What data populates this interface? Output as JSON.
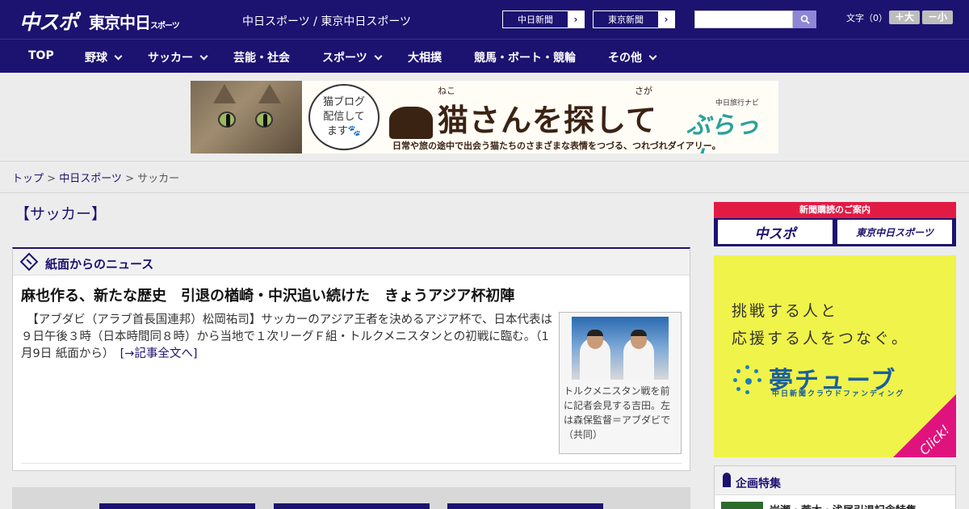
{
  "header": {
    "logo_chuspo": "中スポ",
    "logo_tokyo": "東京中日",
    "logo_tokyo_small": "スポーツ",
    "site_names": "中日スポーツ / 東京中日スポーツ",
    "btn_chunichi": "中日新聞",
    "btn_tokyo": "東京新聞",
    "arrow": "›",
    "search_placeholder": "",
    "fontsize_label": "文字（0）",
    "font_larger": "＋大",
    "font_smaller": "－小"
  },
  "nav": {
    "items": [
      {
        "label": "TOP",
        "dropdown": false
      },
      {
        "label": "野球",
        "dropdown": true
      },
      {
        "label": "サッカー",
        "dropdown": true
      },
      {
        "label": "芸能・社会",
        "dropdown": false
      },
      {
        "label": "スポーツ",
        "dropdown": true
      },
      {
        "label": "大相撲",
        "dropdown": false
      },
      {
        "label": "競馬・ボート・競輪",
        "dropdown": false
      },
      {
        "label": "その他",
        "dropdown": true
      }
    ]
  },
  "banner": {
    "bubble_line1": "猫ブログ",
    "bubble_line2": "配信して",
    "bubble_line3": "ます🐾",
    "ruby1": "ねこ",
    "ruby2": "さが",
    "title": "猫さんを探して",
    "brand_small": "中日旅行ナビ",
    "brand": "ぶらっ人",
    "subtitle": "日常や旅の途中で出会う猫たちのさまざまな表情をつづる、つれづれダイアリー。"
  },
  "breadcrumb": {
    "top": "トップ",
    "sep": " > ",
    "chunichi": "中日スポーツ",
    "current": "サッカー"
  },
  "main": {
    "heading": "【サッカー】",
    "section_title": "紙面からのニュース",
    "article_title": "麻也作る、新たな歴史　引退の楢崎・中沢追い続けた　きょうアジア杯初陣",
    "article_body": "　【アブダビ（アラブ首長国連邦）松岡祐司】サッカーのアジア王者を決めるアジア杯で、日本代表は９日午後３時（日本時間同８時）から当地で１次リーグＦ組・トルクメニスタンとの初戦に臨む。（1月9日 紙面から）　",
    "more_link": "[→記事全文へ]",
    "photo_caption": "トルクメニスタン戦を前に記者会見する吉田。左は森保監督＝アブダビで（共同）"
  },
  "sidebar": {
    "subscribe_bar": "新聞購読のご案内",
    "subscribe_chuspo": "中スポ",
    "subscribe_tokyo": "東京中日スポーツ",
    "ad_line1": "挑戦する人と",
    "ad_line2": "応援する人をつなぐ。",
    "ad_brand": "夢チューブ",
    "ad_brand_sub": "中日新聞クラウドファンディング",
    "ad_click": "Click!",
    "feature_title": "企画特集",
    "feature_item": "岩瀬・荒木・浅尾引退記念特集"
  },
  "colors": {
    "brand_navy": "#1c1270",
    "accent_red": "#e21b45",
    "ad_yellow": "#f0f34a",
    "ad_pink": "#e0137e"
  }
}
